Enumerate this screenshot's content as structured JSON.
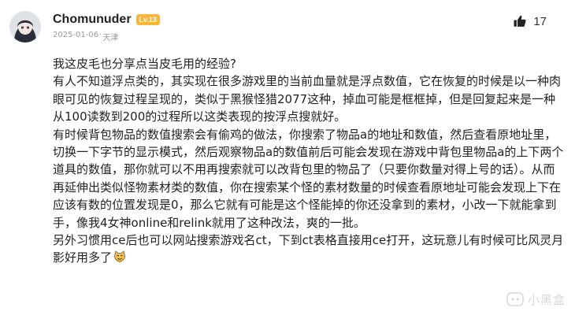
{
  "comment": {
    "username": "Chomunuder",
    "level_badge": "Lv.13",
    "date": "2025-01-06",
    "location": "天津",
    "like_count": "17",
    "paragraphs": [
      "我这皮毛也分享点当皮毛用的经验?",
      "有人不知道浮点类的，其实现在很多游戏里的当前血量就是浮点数值，它在恢复的时候是以一种肉眼可见的恢复过程呈现的，类似于黑猴怪猎2077这种，掉血可能是框框掉，但是回复起来是一种从100读数到200的过程所以这类表现的按浮点搜就好。",
      "有时候背包物品的数值搜索会有偷鸡的做法，你搜索了物品a的地址和数值，然后查看原地址里，切换一下字节的显示模式，然后观察物品a的数值前后可能会发现在游戏中背包里物品a的上下两个道具的数值，那你就可以不用再搜索就可以改背包里的物品了（只要你数量对得上号的话）。从而再延伸出类似怪物素材类的数值，你在搜索某个怪的素材数量的时候查看原地址可能会发现上下在应该有数的位置发现是0，那么它就有可能是这个怪能掉的你还没拿到的素材，小改一下就能拿到手，像我4女神online和relink就用了这种改法，爽的一批。",
      "另外习惯用ce后也可以网站搜索游戏名ct，下到ct表格直接用ce打开，这玩意儿有时候可比风灵月影好用多了"
    ],
    "emoji": "cat-face-emoji"
  },
  "watermark": {
    "text": "小黑盒"
  },
  "colors": {
    "badge": "#f6b73c",
    "text": "#222222",
    "meta": "#999999"
  }
}
